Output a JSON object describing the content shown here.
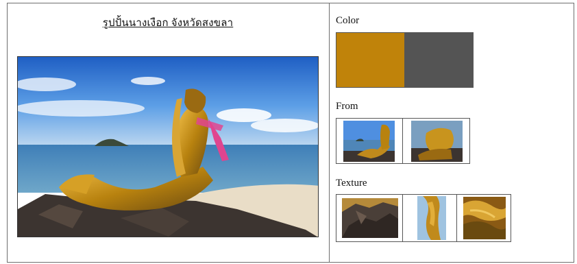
{
  "image_title": "รูปปั้นนางเงือก จังหวัดสงขลา",
  "sections": {
    "color_label": "Color",
    "form_label": "From",
    "texture_label": "Texture"
  },
  "colors": {
    "swatch_1": "#c0830a",
    "swatch_2": "#545454"
  },
  "images": {
    "main_photo": "mermaid-statue-photo",
    "form_1": "mermaid-statue-crop",
    "form_2": "mermaid-head-crop",
    "texture_1": "rock-texture",
    "texture_2": "hair-texture",
    "texture_3": "bronze-texture"
  }
}
